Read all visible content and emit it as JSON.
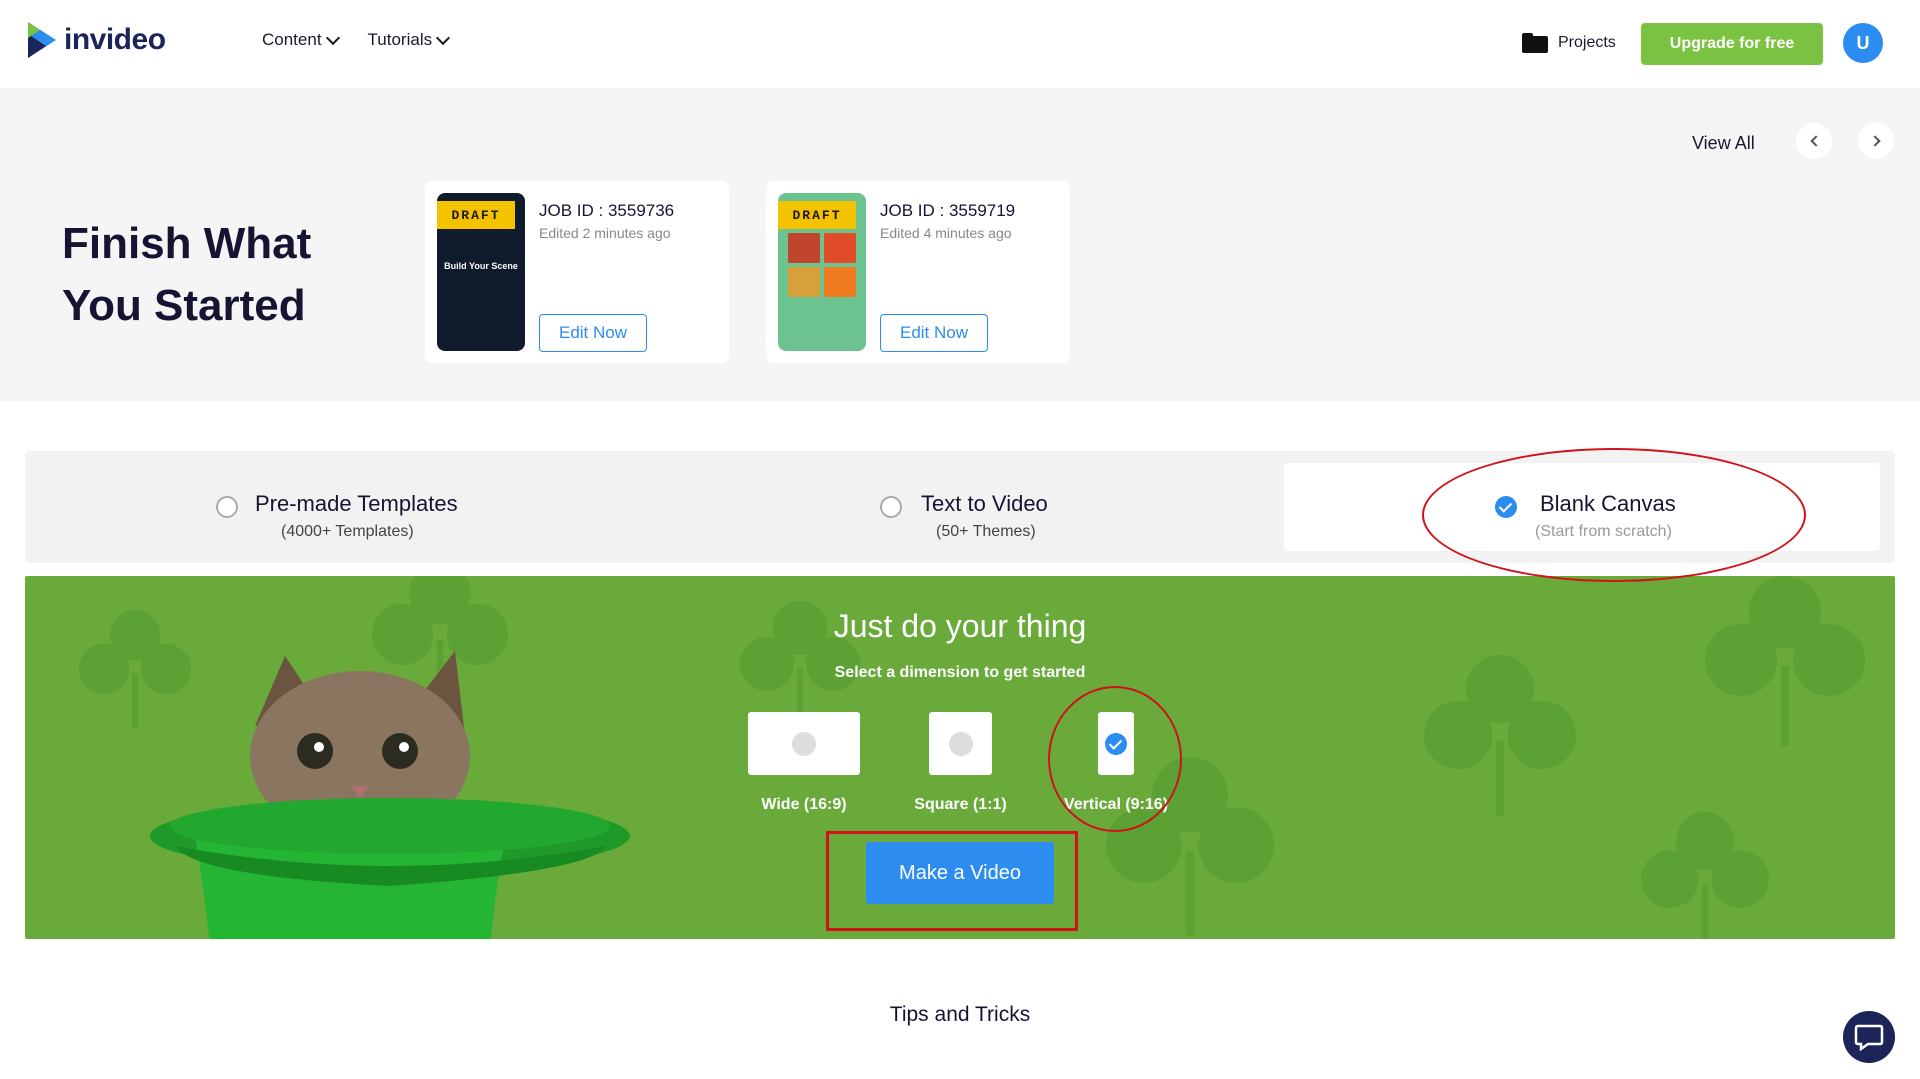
{
  "header": {
    "logo_text": "invideo",
    "nav": [
      {
        "label": "Content"
      },
      {
        "label": "Tutorials"
      }
    ],
    "projects_label": "Projects",
    "upgrade_label": "Upgrade for free",
    "avatar_initial": "U"
  },
  "finish": {
    "title": "Finish What You Started",
    "view_all_label": "View All",
    "jobs": [
      {
        "draft_badge": "DRAFT",
        "job_id": "JOB ID : 3559736",
        "edited": "Edited 2 minutes ago",
        "edit_label": "Edit Now",
        "thumb_text": "Build Your Scene"
      },
      {
        "draft_badge": "DRAFT",
        "job_id": "JOB ID : 3559719",
        "edited": "Edited 4 minutes ago",
        "edit_label": "Edit Now"
      }
    ]
  },
  "modes": [
    {
      "title": "Pre-made Templates",
      "sub": "(4000+ Templates)",
      "selected": false
    },
    {
      "title": "Text to Video",
      "sub": "(50+ Themes)",
      "selected": false
    },
    {
      "title": "Blank Canvas",
      "sub": "(Start from scratch)",
      "selected": true
    }
  ],
  "banner": {
    "title": "Just do your thing",
    "subtitle": "Select a dimension to get started",
    "dimensions": [
      {
        "label": "Wide (16:9)",
        "selected": false
      },
      {
        "label": "Square (1:1)",
        "selected": false
      },
      {
        "label": "Vertical (9:16)",
        "selected": true
      }
    ],
    "make_label": "Make a Video"
  },
  "tips_label": "Tips and Tricks",
  "colors": {
    "accent_blue": "#2d8cf0",
    "upgrade_green": "#7cc242",
    "banner_green": "#6aaa3a",
    "draft_yellow": "#f5c200",
    "annotation_red": "#d0121b"
  },
  "icons": [
    "invideo-logo-icon",
    "chevron-down-icon",
    "folder-icon",
    "chevron-left-icon",
    "chevron-right-icon",
    "check-icon",
    "chat-icon",
    "clover-icon",
    "kitten-in-hat-illustration"
  ]
}
